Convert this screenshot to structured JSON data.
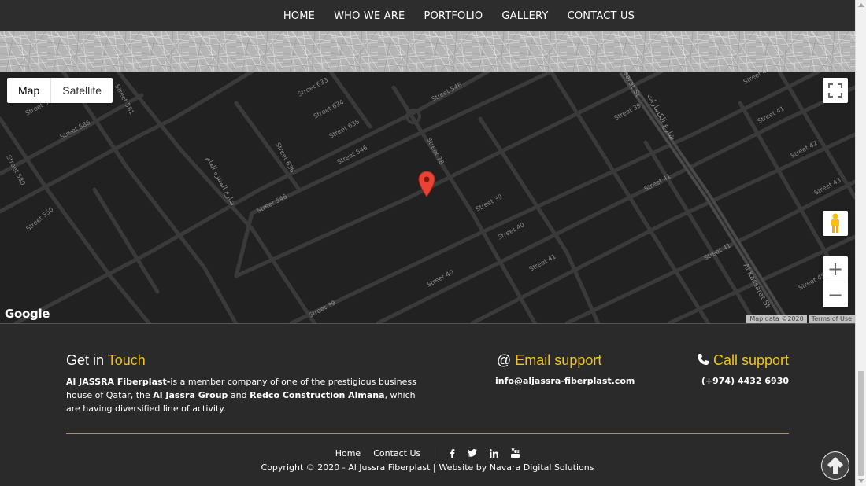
{
  "nav": {
    "items": [
      {
        "label": "HOME"
      },
      {
        "label": "WHO WE ARE"
      },
      {
        "label": "PORTFOLIO"
      },
      {
        "label": "GALLERY"
      },
      {
        "label": "CONTACT US"
      }
    ]
  },
  "map": {
    "type_map": "Map",
    "type_satellite": "Satellite",
    "zoom_in": "+",
    "zoom_out": "−",
    "logo": "Google",
    "map_data": "Map data ©2020",
    "terms": "Terms of Use",
    "street_labels": {
      "s633": "Street 633",
      "s634": "Street 634",
      "s635": "Street 635",
      "s546a": "Street 546",
      "s546b": "Street 546",
      "s546c": "Street 546",
      "s636": "Street 636",
      "s78": "Street 78",
      "s39a": "Street 39",
      "s39b": "Street 39",
      "s39c": "Street 39",
      "s40a": "Street 40",
      "s40b": "Street 40",
      "s40c": "Street 40",
      "s41a": "Street 41",
      "s41b": "Street 41",
      "s41c": "Street 41",
      "s41d": "Street 41",
      "s42": "Street 42",
      "s43": "Street 43",
      "s45": "Street 45",
      "s550": "Street 550",
      "s580": "Street 580",
      "s586": "Street 586",
      "s581": "Street 581",
      "s585": "Street 585",
      "kassarat1": "Al Kassarat St",
      "kassarat2": "sarat St",
      "kassarat_ar": "شارع الكسارات",
      "arabic_st": "شارع المنتزه العام"
    },
    "colors": {
      "background": "#212121",
      "road": "#3c3c3c",
      "highway": "#4a4a4a",
      "label": "#8a8a8a",
      "pin": "#ea4335"
    }
  },
  "footer": {
    "get_in": "Get in",
    "touch": "Touch",
    "about_brand": "Al JASSRA Fiberplast-",
    "about_text1": "is a member company of one of the prestigious business house of Qatar, the ",
    "about_group": "Al Jassra Group",
    "about_and": " and ",
    "about_redco": "Redco Construction Almana",
    "about_text2": ", which are having diversified line of activity.",
    "email_prefix": "@",
    "email_title": "Email support",
    "email_value": "info@aljassra-fiberplast.com",
    "call_title": "Call support",
    "phone_value": "(+974) 4432 6930",
    "link_home": "Home",
    "link_contact": "Contact Us",
    "copyright": "Copyright © 2020 - Al Jussra Fiberplast",
    "copyright_sep": "|",
    "credit": "Website by Navara Digital Solutions",
    "accent_color": "#f3c31a"
  }
}
